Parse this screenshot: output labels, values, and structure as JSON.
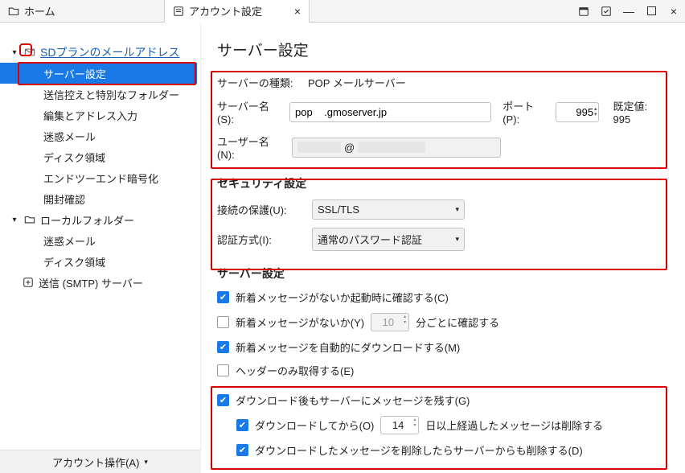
{
  "titlebar": {
    "home_tab": "ホーム",
    "settings_tab": "アカウント設定"
  },
  "sidebar": {
    "account_root": "SDプランのメールアドレス",
    "items": [
      "サーバー設定",
      "送信控えと特別なフォルダー",
      "編集とアドレス入力",
      "迷惑メール",
      "ディスク領域",
      "エンドツーエンド暗号化",
      "開封確認"
    ],
    "local_root": "ローカルフォルダー",
    "local_items": [
      "迷惑メール",
      "ディスク領域"
    ],
    "smtp": "送信 (SMTP) サーバー",
    "footer_btn": "アカウント操作(A)"
  },
  "content": {
    "title": "サーバー設定",
    "server_type_label": "サーバーの種類:",
    "server_type_value": "POP メールサーバー",
    "server_name_label": "サーバー名(S):",
    "server_name_value": "pop    .gmoserver.jp",
    "port_label": "ポート(P):",
    "port_value": "995",
    "port_default_label": "既定値: 995",
    "user_label": "ユーザー名(N):",
    "user_value_left": "          ",
    "user_value_at": "@",
    "user_value_right": "               ",
    "security_heading": "セキュリティ設定",
    "conn_sec_label": "接続の保護(U):",
    "conn_sec_value": "SSL/TLS",
    "auth_label": "認証方式(I):",
    "auth_value": "通常のパスワード認証",
    "server_settings_heading": "サーバー設定",
    "chk_startup": "新着メッセージがないか起動時に確認する(C)",
    "chk_interval_pre": "新着メッセージがないか(Y)",
    "chk_interval_num": "10",
    "chk_interval_post": "分ごとに確認する",
    "chk_auto_dl": "新着メッセージを自動的にダウンロードする(M)",
    "chk_headers": "ヘッダーのみ取得する(E)",
    "chk_leave": "ダウンロード後もサーバーにメッセージを残す(G)",
    "chk_leave_days_pre": "ダウンロードしてから(O)",
    "chk_leave_days_num": "14",
    "chk_leave_days_post": "日以上経過したメッセージは削除する",
    "chk_delete_sync": "ダウンロードしたメッセージを削除したらサーバーからも削除する(D)"
  }
}
